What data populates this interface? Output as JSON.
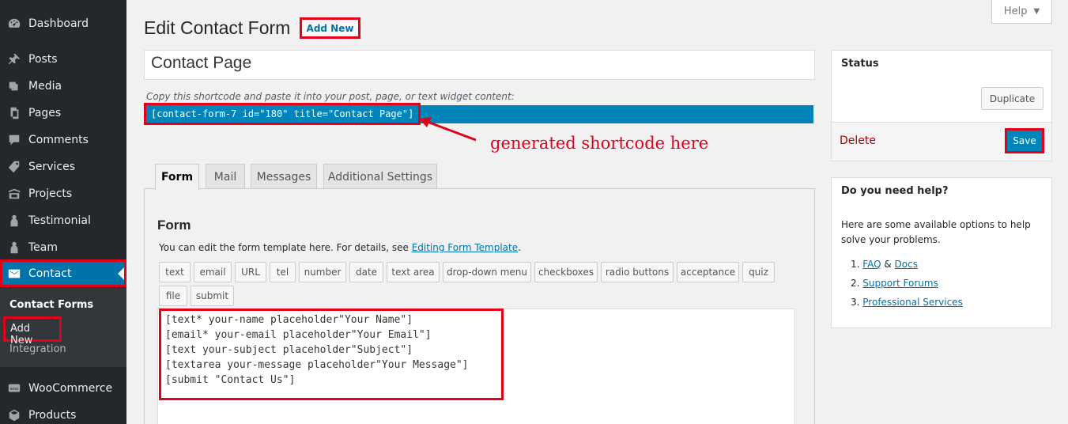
{
  "sidebar": {
    "items": [
      {
        "label": "Dashboard",
        "icon": "dashboard-icon"
      },
      {
        "label": "Posts",
        "icon": "pin-icon"
      },
      {
        "label": "Media",
        "icon": "media-icon"
      },
      {
        "label": "Pages",
        "icon": "pages-icon"
      },
      {
        "label": "Comments",
        "icon": "comment-icon"
      },
      {
        "label": "Services",
        "icon": "tag-icon"
      },
      {
        "label": "Projects",
        "icon": "portfolio-icon"
      },
      {
        "label": "Testimonial",
        "icon": "person-icon"
      },
      {
        "label": "Team",
        "icon": "person-icon"
      },
      {
        "label": "Contact",
        "icon": "envelope-icon"
      },
      {
        "label": "WooCommerce",
        "icon": "woo-icon"
      },
      {
        "label": "Products",
        "icon": "box-icon"
      }
    ],
    "submenu": [
      "Contact Forms",
      "Add New",
      "Integration"
    ]
  },
  "header": {
    "title": "Edit Contact Form",
    "add_new": "Add New",
    "help": "Help",
    "help_caret": "▼"
  },
  "form_title_value": "Contact Page",
  "shortcode": {
    "description": "Copy this shortcode and paste it into your post, page, or text widget content:",
    "code": "[contact-form-7 id=\"180\" title=\"Contact Page\"]"
  },
  "annotation": "generated shortcode here",
  "tabs": [
    "Form",
    "Mail",
    "Messages",
    "Additional Settings"
  ],
  "form_panel": {
    "heading": "Form",
    "desc_prefix": "You can edit the form template here. For details, see ",
    "desc_link": "Editing Form Template",
    "desc_suffix": ".",
    "tag_buttons": [
      "text",
      "email",
      "URL",
      "tel",
      "number",
      "date",
      "text area",
      "drop-down menu",
      "checkboxes",
      "radio buttons",
      "acceptance",
      "quiz",
      "file",
      "submit"
    ],
    "template": "[text* your-name placeholder\"Your Name\"]\n[email* your-email placeholder\"Your Email\"]\n[text your-subject placeholder\"Subject\"]\n[textarea your-message placeholder\"Your Message\"]\n[submit \"Contact Us\"]"
  },
  "status": {
    "title": "Status",
    "duplicate": "Duplicate",
    "delete": "Delete",
    "save": "Save"
  },
  "help_box": {
    "title": "Do you need help?",
    "text": "Here are some available options to help solve your problems.",
    "items": [
      {
        "num": "1.",
        "link1": "FAQ",
        "sep": " & ",
        "link2": "Docs"
      },
      {
        "num": "2.",
        "link1": "Support Forums"
      },
      {
        "num": "3.",
        "link1": "Professional Services"
      }
    ]
  },
  "colors": {
    "sidebar_bg": "#23282d",
    "active_bg": "#0073aa",
    "highlight_red": "#e3001b",
    "link": "#0073aa"
  }
}
